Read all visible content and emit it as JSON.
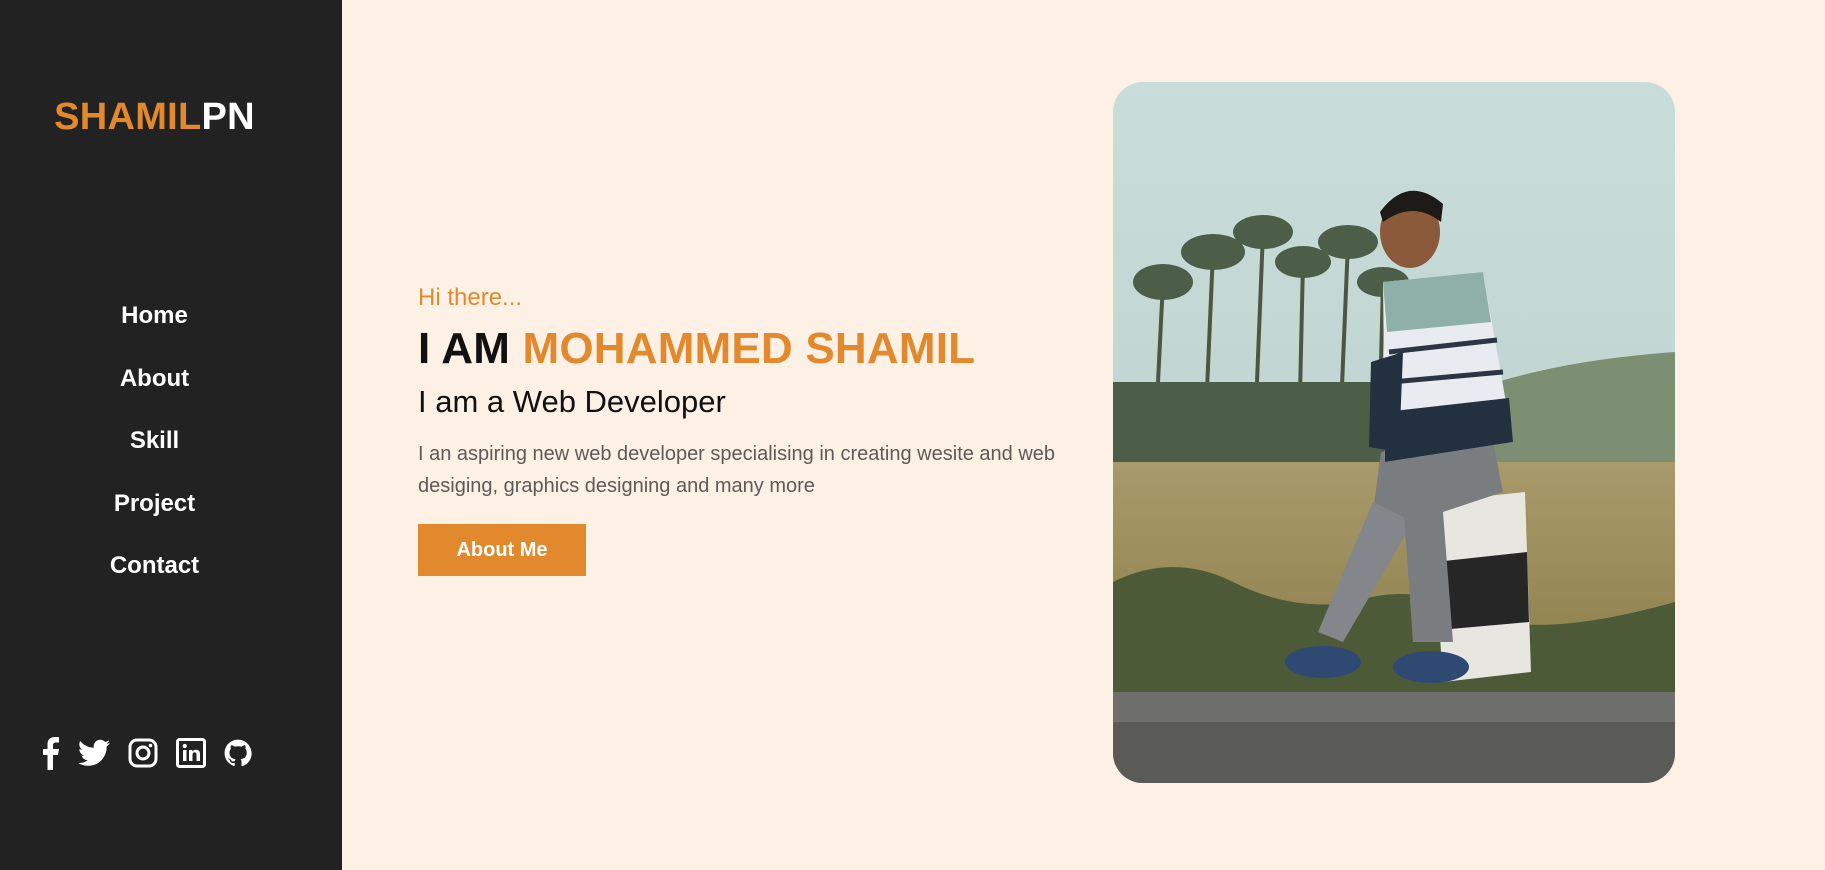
{
  "brand": {
    "first": "SHAMIL",
    "second": "PN"
  },
  "nav": {
    "items": [
      {
        "label": "Home"
      },
      {
        "label": "About"
      },
      {
        "label": "Skill"
      },
      {
        "label": "Project"
      },
      {
        "label": "Contact"
      }
    ]
  },
  "social": {
    "icons": [
      "facebook-icon",
      "twitter-icon",
      "instagram-icon",
      "linkedin-icon",
      "github-icon"
    ]
  },
  "hero": {
    "greeting": "Hi there...",
    "title_prefix": "I AM ",
    "title_name": "MOHAMMED SHAMIL",
    "role": "I am a Web Developer",
    "description": "I an aspiring new web developer specialising in creating wesite and web desiging, graphics designing and many more",
    "button_label": "About Me"
  },
  "colors": {
    "accent": "#e2892d",
    "sidebar": "#222222",
    "background": "#fdf1e6"
  }
}
